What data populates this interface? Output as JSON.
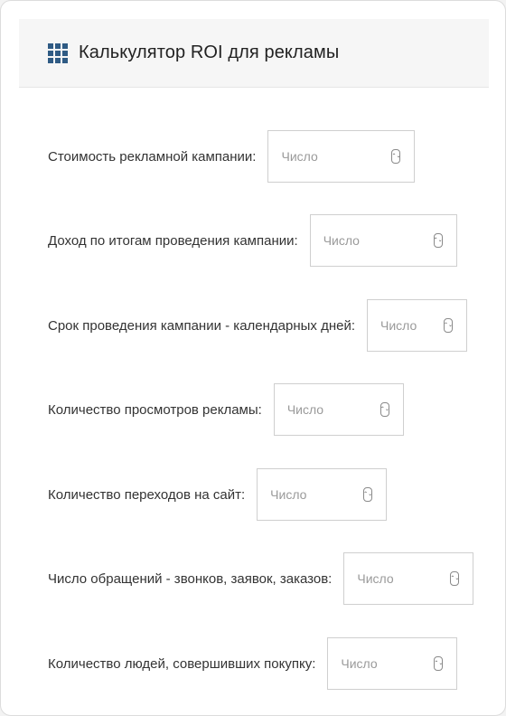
{
  "header": {
    "icon": "grid-icon",
    "title": "Калькулятор ROI для рекламы"
  },
  "accent_color": "#2f5b84",
  "fields": [
    {
      "label": "Стоимость рекламной кампании:",
      "placeholder": "Число",
      "value": ""
    },
    {
      "label": "Доход по итогам проведения кампании:",
      "placeholder": "Число",
      "value": ""
    },
    {
      "label": "Срок проведения кампании - календарных дней:",
      "placeholder": "Число",
      "value": ""
    },
    {
      "label": "Количество просмотров рекламы:",
      "placeholder": "Число",
      "value": ""
    },
    {
      "label": "Количество переходов на сайт:",
      "placeholder": "Число",
      "value": ""
    },
    {
      "label": "Число обращений - звонков, заявок, заказов:",
      "placeholder": "Число",
      "value": ""
    },
    {
      "label": "Количество людей, совершивших покупку:",
      "placeholder": "Число",
      "value": ""
    }
  ]
}
